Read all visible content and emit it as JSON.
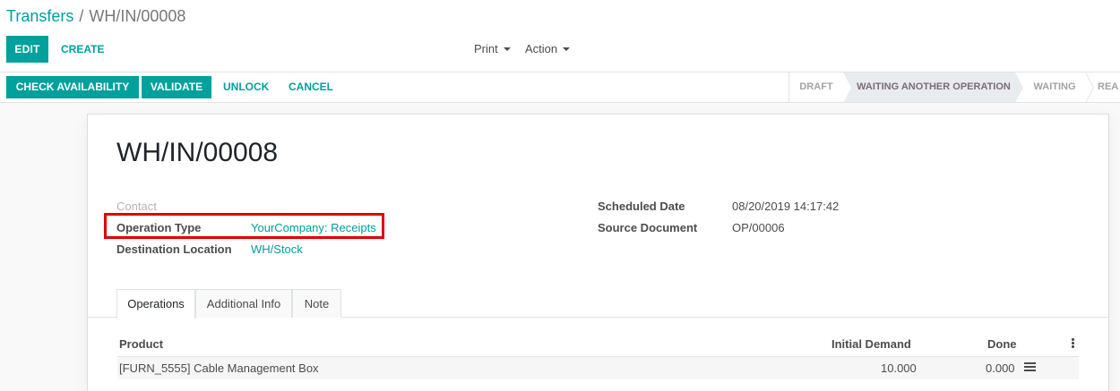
{
  "breadcrumb": {
    "parent": "Transfers",
    "separator": "/",
    "current": "WH/IN/00008"
  },
  "toolbar": {
    "edit": "EDIT",
    "create": "CREATE",
    "print": "Print",
    "action": "Action"
  },
  "statusbar": {
    "buttons": [
      "CHECK AVAILABILITY",
      "VALIDATE"
    ],
    "links": [
      "UNLOCK",
      "CANCEL"
    ],
    "stages": [
      "DRAFT",
      "WAITING ANOTHER OPERATION",
      "WAITING",
      "REA"
    ]
  },
  "record": {
    "title": "WH/IN/00008",
    "contact_label": "Contact",
    "operation_type_label": "Operation Type",
    "operation_type_value": "YourCompany: Receipts",
    "destination_label": "Destination Location",
    "destination_value": "WH/Stock",
    "scheduled_label": "Scheduled Date",
    "scheduled_value": "08/20/2019 14:17:42",
    "source_label": "Source Document",
    "source_value": "OP/00006"
  },
  "tabs": [
    "Operations",
    "Additional Info",
    "Note"
  ],
  "table": {
    "headers": [
      "Product",
      "Initial Demand",
      "Done"
    ],
    "rows": [
      {
        "product": "[FURN_5555] Cable Management Box",
        "initial_demand": "10.000",
        "done": "0.000"
      }
    ]
  },
  "colors": {
    "accent": "#00a09d",
    "highlight": "#e00000"
  }
}
